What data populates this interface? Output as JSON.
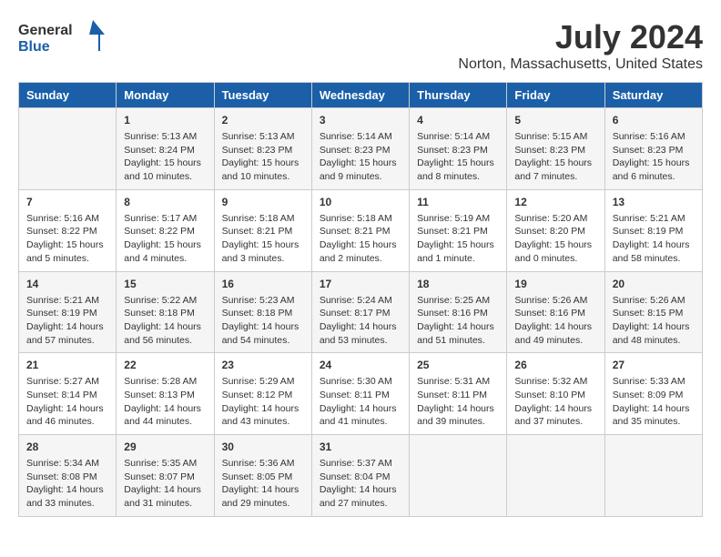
{
  "logo": {
    "general": "General",
    "blue": "Blue"
  },
  "title": "July 2024",
  "subtitle": "Norton, Massachusetts, United States",
  "days_of_week": [
    "Sunday",
    "Monday",
    "Tuesday",
    "Wednesday",
    "Thursday",
    "Friday",
    "Saturday"
  ],
  "weeks": [
    [
      {
        "num": "",
        "info": ""
      },
      {
        "num": "1",
        "info": "Sunrise: 5:13 AM\nSunset: 8:24 PM\nDaylight: 15 hours\nand 10 minutes."
      },
      {
        "num": "2",
        "info": "Sunrise: 5:13 AM\nSunset: 8:23 PM\nDaylight: 15 hours\nand 10 minutes."
      },
      {
        "num": "3",
        "info": "Sunrise: 5:14 AM\nSunset: 8:23 PM\nDaylight: 15 hours\nand 9 minutes."
      },
      {
        "num": "4",
        "info": "Sunrise: 5:14 AM\nSunset: 8:23 PM\nDaylight: 15 hours\nand 8 minutes."
      },
      {
        "num": "5",
        "info": "Sunrise: 5:15 AM\nSunset: 8:23 PM\nDaylight: 15 hours\nand 7 minutes."
      },
      {
        "num": "6",
        "info": "Sunrise: 5:16 AM\nSunset: 8:23 PM\nDaylight: 15 hours\nand 6 minutes."
      }
    ],
    [
      {
        "num": "7",
        "info": "Sunrise: 5:16 AM\nSunset: 8:22 PM\nDaylight: 15 hours\nand 5 minutes."
      },
      {
        "num": "8",
        "info": "Sunrise: 5:17 AM\nSunset: 8:22 PM\nDaylight: 15 hours\nand 4 minutes."
      },
      {
        "num": "9",
        "info": "Sunrise: 5:18 AM\nSunset: 8:21 PM\nDaylight: 15 hours\nand 3 minutes."
      },
      {
        "num": "10",
        "info": "Sunrise: 5:18 AM\nSunset: 8:21 PM\nDaylight: 15 hours\nand 2 minutes."
      },
      {
        "num": "11",
        "info": "Sunrise: 5:19 AM\nSunset: 8:21 PM\nDaylight: 15 hours\nand 1 minute."
      },
      {
        "num": "12",
        "info": "Sunrise: 5:20 AM\nSunset: 8:20 PM\nDaylight: 15 hours\nand 0 minutes."
      },
      {
        "num": "13",
        "info": "Sunrise: 5:21 AM\nSunset: 8:19 PM\nDaylight: 14 hours\nand 58 minutes."
      }
    ],
    [
      {
        "num": "14",
        "info": "Sunrise: 5:21 AM\nSunset: 8:19 PM\nDaylight: 14 hours\nand 57 minutes."
      },
      {
        "num": "15",
        "info": "Sunrise: 5:22 AM\nSunset: 8:18 PM\nDaylight: 14 hours\nand 56 minutes."
      },
      {
        "num": "16",
        "info": "Sunrise: 5:23 AM\nSunset: 8:18 PM\nDaylight: 14 hours\nand 54 minutes."
      },
      {
        "num": "17",
        "info": "Sunrise: 5:24 AM\nSunset: 8:17 PM\nDaylight: 14 hours\nand 53 minutes."
      },
      {
        "num": "18",
        "info": "Sunrise: 5:25 AM\nSunset: 8:16 PM\nDaylight: 14 hours\nand 51 minutes."
      },
      {
        "num": "19",
        "info": "Sunrise: 5:26 AM\nSunset: 8:16 PM\nDaylight: 14 hours\nand 49 minutes."
      },
      {
        "num": "20",
        "info": "Sunrise: 5:26 AM\nSunset: 8:15 PM\nDaylight: 14 hours\nand 48 minutes."
      }
    ],
    [
      {
        "num": "21",
        "info": "Sunrise: 5:27 AM\nSunset: 8:14 PM\nDaylight: 14 hours\nand 46 minutes."
      },
      {
        "num": "22",
        "info": "Sunrise: 5:28 AM\nSunset: 8:13 PM\nDaylight: 14 hours\nand 44 minutes."
      },
      {
        "num": "23",
        "info": "Sunrise: 5:29 AM\nSunset: 8:12 PM\nDaylight: 14 hours\nand 43 minutes."
      },
      {
        "num": "24",
        "info": "Sunrise: 5:30 AM\nSunset: 8:11 PM\nDaylight: 14 hours\nand 41 minutes."
      },
      {
        "num": "25",
        "info": "Sunrise: 5:31 AM\nSunset: 8:11 PM\nDaylight: 14 hours\nand 39 minutes."
      },
      {
        "num": "26",
        "info": "Sunrise: 5:32 AM\nSunset: 8:10 PM\nDaylight: 14 hours\nand 37 minutes."
      },
      {
        "num": "27",
        "info": "Sunrise: 5:33 AM\nSunset: 8:09 PM\nDaylight: 14 hours\nand 35 minutes."
      }
    ],
    [
      {
        "num": "28",
        "info": "Sunrise: 5:34 AM\nSunset: 8:08 PM\nDaylight: 14 hours\nand 33 minutes."
      },
      {
        "num": "29",
        "info": "Sunrise: 5:35 AM\nSunset: 8:07 PM\nDaylight: 14 hours\nand 31 minutes."
      },
      {
        "num": "30",
        "info": "Sunrise: 5:36 AM\nSunset: 8:05 PM\nDaylight: 14 hours\nand 29 minutes."
      },
      {
        "num": "31",
        "info": "Sunrise: 5:37 AM\nSunset: 8:04 PM\nDaylight: 14 hours\nand 27 minutes."
      },
      {
        "num": "",
        "info": ""
      },
      {
        "num": "",
        "info": ""
      },
      {
        "num": "",
        "info": ""
      }
    ]
  ],
  "colors": {
    "header_bg": "#1a5fa8",
    "header_text": "#ffffff",
    "row_odd": "#f5f5f5",
    "row_even": "#ffffff"
  }
}
